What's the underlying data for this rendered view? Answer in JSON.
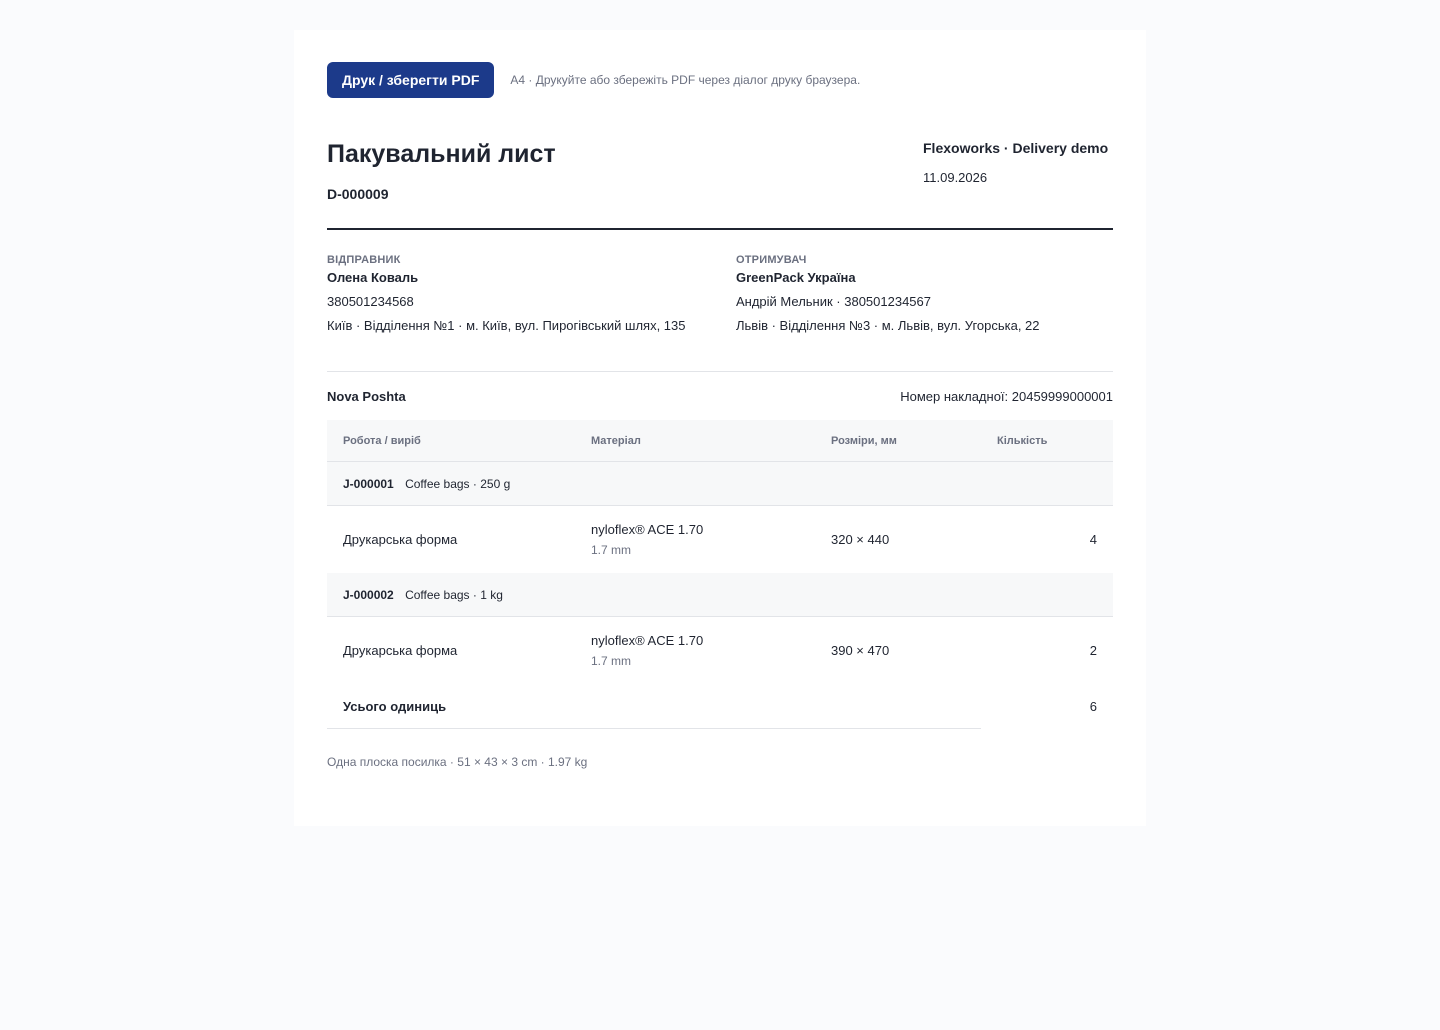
{
  "toolbar": {
    "print_label": "Друк / зберегти PDF",
    "hint": "A4 · Друкуйте або збережіть PDF через діалог друку браузера."
  },
  "header": {
    "title": "Пакувальний лист",
    "number": "D-000009",
    "company": "Flexoworks · Delivery demo",
    "date": "11.09.2026"
  },
  "sender": {
    "label": "ВІДПРАВНИК",
    "name": "Олена Коваль",
    "phone": "380501234568",
    "address": "Київ · Відділення №1 · м. Київ, вул. Пирогівський шлях, 135"
  },
  "recipient": {
    "label": "ОТРИМУВАЧ",
    "name": "GreenPack Україна",
    "contact": "Андрій Мельник · 380501234567",
    "address": "Львів · Відділення №3 · м. Львів, вул. Угорська, 22"
  },
  "shipping": {
    "carrier": "Nova Poshta",
    "waybill": "Номер накладної: 20459999000001"
  },
  "table": {
    "headers": {
      "job": "Робота / виріб",
      "material": "Матеріал",
      "size": "Розміри, мм",
      "qty": "Кількість"
    },
    "groups": [
      {
        "job_id": "J-000001",
        "job_name": "Coffee bags · 250 g",
        "item": {
          "name": "Друкарська форма",
          "material": "nyloflex® ACE 1.70",
          "thickness": "1.7 mm",
          "size": "320 × 440",
          "qty": "4"
        }
      },
      {
        "job_id": "J-000002",
        "job_name": "Coffee bags · 1 kg",
        "item": {
          "name": "Друкарська форма",
          "material": "nyloflex® ACE 1.70",
          "thickness": "1.7 mm",
          "size": "390 × 470",
          "qty": "2"
        }
      }
    ],
    "total_label": "Усього одиниць",
    "total_qty": "6"
  },
  "footnote": "Одна плоска посилка · 51 × 43 × 3 cm · 1.97 kg"
}
